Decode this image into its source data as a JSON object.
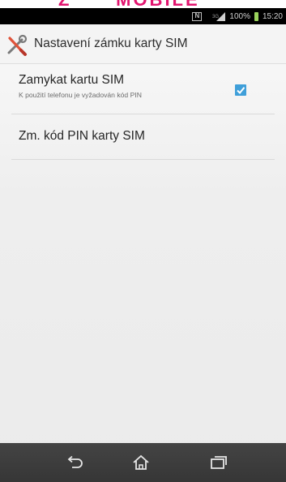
{
  "banner": {
    "text": "Ž      MOBILE"
  },
  "statusbar": {
    "battery_percent": "100%",
    "time": "15:20",
    "icons": [
      "nfc-icon",
      "signal-icon",
      "battery-icon"
    ]
  },
  "appbar": {
    "icon": "wrench-screwdriver-icon",
    "title": "Nastavení zámku karty SIM"
  },
  "preferences": [
    {
      "title": "Zamykat kartu SIM",
      "summary": "K použití telefonu je vyžadován kód PIN",
      "checked": true
    },
    {
      "title": "Zm. kód PIN karty SIM"
    }
  ],
  "navbar": {
    "icons": [
      "back-icon",
      "home-icon",
      "recent-apps-icon"
    ]
  },
  "colors": {
    "accent": "#3f9fd9",
    "banner": "#e2156f",
    "statusbar": "#000000",
    "navbar": "#3b3b3b",
    "battery": "#9ad35c"
  }
}
